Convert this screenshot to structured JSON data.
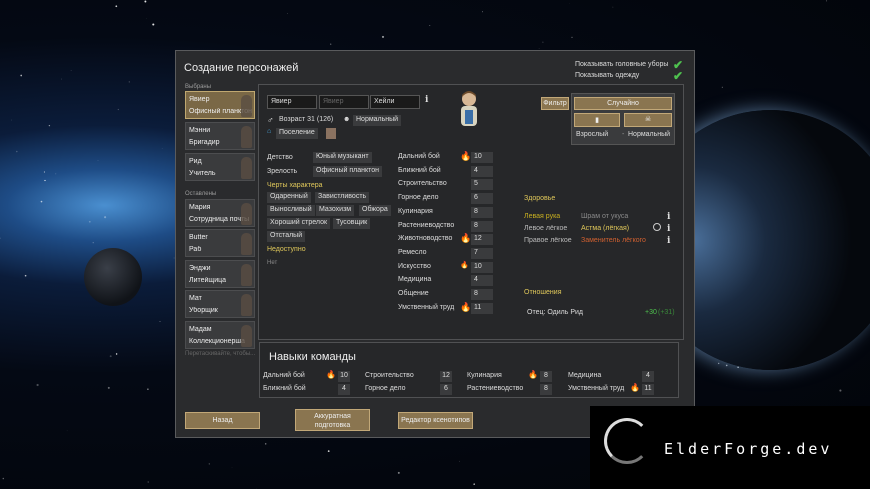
{
  "window": {
    "title": "Создание персонажей",
    "toggles": [
      "Показывать головные уборы",
      "Показывать одежду"
    ]
  },
  "pawn_list": {
    "group_chosen": "Выбраны",
    "group_left": "Оставлены",
    "chosen": [
      {
        "name": "Явиер",
        "role": "Офисный планктон"
      },
      {
        "name": "Мэнни",
        "role": "Бригадир"
      },
      {
        "name": "Рид",
        "role": "Учитель"
      }
    ],
    "left": [
      {
        "name": "Мария",
        "role": "Сотрудница почты"
      },
      {
        "name": "Butter",
        "role": "Раб"
      },
      {
        "name": "Энджи",
        "role": "Литейщица"
      },
      {
        "name": "Мат",
        "role": "Уборщик"
      },
      {
        "name": "Мадам",
        "role": "Коллекционерша"
      }
    ],
    "hint": "Перетаскивайте, чтобы..."
  },
  "character": {
    "first_name": "Явиер",
    "nick_placeholder": "Явиер",
    "last_name": "Хейли",
    "age": "Возраст 31 (126)",
    "mood": "Нормальный",
    "faction": "Поселение",
    "childhood_label": "Детство",
    "childhood": "Юный музыкант",
    "adulthood_label": "Зрелость",
    "adulthood": "Офисный планктон",
    "traits_label": "Черты характера",
    "traits": [
      "Одаренный",
      "Завистливость",
      "Выносливый",
      "Мазохизм",
      "Обжора",
      "Хороший стрелок",
      "Тусовщик",
      "Отсталый"
    ],
    "unavailable_label": "Недоступно",
    "unavailable_value": "Нет",
    "filter_label": "Фильтр",
    "random_label": "Случайно",
    "stage_label": "Взрослый",
    "state_label": "Нормальный"
  },
  "skills": [
    {
      "name": "Дальний бой",
      "value": "10",
      "passion": 2
    },
    {
      "name": "Ближний бой",
      "value": "4",
      "passion": 0
    },
    {
      "name": "Строительство",
      "value": "5",
      "passion": 0
    },
    {
      "name": "Горное дело",
      "value": "6",
      "passion": 0
    },
    {
      "name": "Кулинария",
      "value": "8",
      "passion": 0
    },
    {
      "name": "Растениеводство",
      "value": "8",
      "passion": 0
    },
    {
      "name": "Животноводство",
      "value": "12",
      "passion": 2
    },
    {
      "name": "Ремесло",
      "value": "7",
      "passion": 0
    },
    {
      "name": "Искусство",
      "value": "10",
      "passion": 1
    },
    {
      "name": "Медицина",
      "value": "4",
      "passion": 0
    },
    {
      "name": "Общение",
      "value": "8",
      "passion": 0
    },
    {
      "name": "Умственный труд",
      "value": "11",
      "passion": 2
    }
  ],
  "health": {
    "title": "Здоровье",
    "rows": [
      {
        "part": "Левая рука",
        "cond": "Шрам от укуса",
        "part_color": "#c8b020",
        "cond_color": "#8a8a8a"
      },
      {
        "part": "Левое лёгкое",
        "cond": "Астма (лёгкая)",
        "part_color": "#bbbbbb",
        "cond_color": "#e0c85a"
      },
      {
        "part": "Правое лёгкое",
        "cond": "Заменитель лёгкого",
        "part_color": "#bbbbbb",
        "cond_color": "#d06030"
      }
    ]
  },
  "relations": {
    "title": "Отношения",
    "entry": "Отец: Одиль Рид",
    "opinion": "+30",
    "opinion_extra": "(+31)"
  },
  "team": {
    "title": "Навыки команды",
    "skills": [
      {
        "name": "Дальний бой",
        "value": "10",
        "passion": true
      },
      {
        "name": "Строительство",
        "value": "12",
        "passion": false
      },
      {
        "name": "Кулинария",
        "value": "8",
        "passion": true
      },
      {
        "name": "Медицина",
        "value": "4",
        "passion": false
      },
      {
        "name": "Ближний бой",
        "value": "4",
        "passion": false
      },
      {
        "name": "Горное дело",
        "value": "6",
        "passion": false
      },
      {
        "name": "Растениеводство",
        "value": "8",
        "passion": false
      },
      {
        "name": "Умственный труд",
        "value": "11",
        "passion": true
      }
    ]
  },
  "buttons": {
    "back": "Назад",
    "neat": "Аккуратная подготовка",
    "xeno": "Редактор ксенотипов"
  },
  "watermark": "ElderForge.dev",
  "colors": {
    "accent_green": "#4fc24f",
    "passion": "#f09020",
    "highlight": "#e0c85a"
  }
}
